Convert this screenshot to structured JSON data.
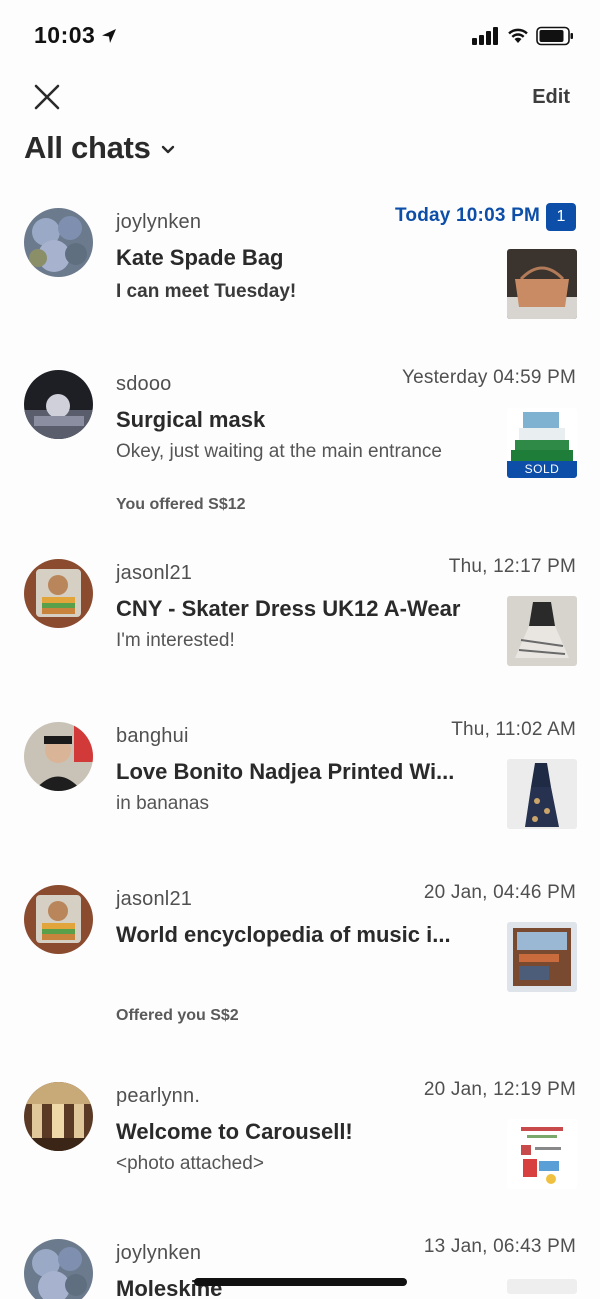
{
  "status_bar": {
    "time": "10:03"
  },
  "header": {
    "edit_label": "Edit",
    "title": "All chats"
  },
  "chats": [
    {
      "username": "joylynken",
      "timestamp": "Today 10:03 PM",
      "unread_count": "1",
      "title": "Kate Spade Bag",
      "preview": "I can meet Tuesday!"
    },
    {
      "username": "sdooo",
      "timestamp": "Yesterday 04:59 PM",
      "title": "Surgical mask",
      "preview": "Okey, just waiting at the main entrance",
      "offer": "You offered S$12",
      "sold_label": "SOLD"
    },
    {
      "username": "jasonl21",
      "timestamp": "Thu, 12:17 PM",
      "title": "CNY - Skater Dress UK12 A-Wear",
      "preview": "I'm interested!"
    },
    {
      "username": "banghui",
      "timestamp": "Thu, 11:02 AM",
      "title": "Love Bonito Nadjea Printed Wi...",
      "preview": "in bananas"
    },
    {
      "username": "jasonl21",
      "timestamp": "20 Jan, 04:46 PM",
      "title": "World encyclopedia of music i...",
      "preview": "",
      "offer": "Offered you S$2"
    },
    {
      "username": "pearlynn.",
      "timestamp": "20 Jan, 12:19 PM",
      "title": "Welcome to Carousell!",
      "preview": "<photo attached>"
    },
    {
      "username": "joylynken",
      "timestamp": "13 Jan, 06:43 PM",
      "title": "Moleskine",
      "preview": ""
    }
  ]
}
